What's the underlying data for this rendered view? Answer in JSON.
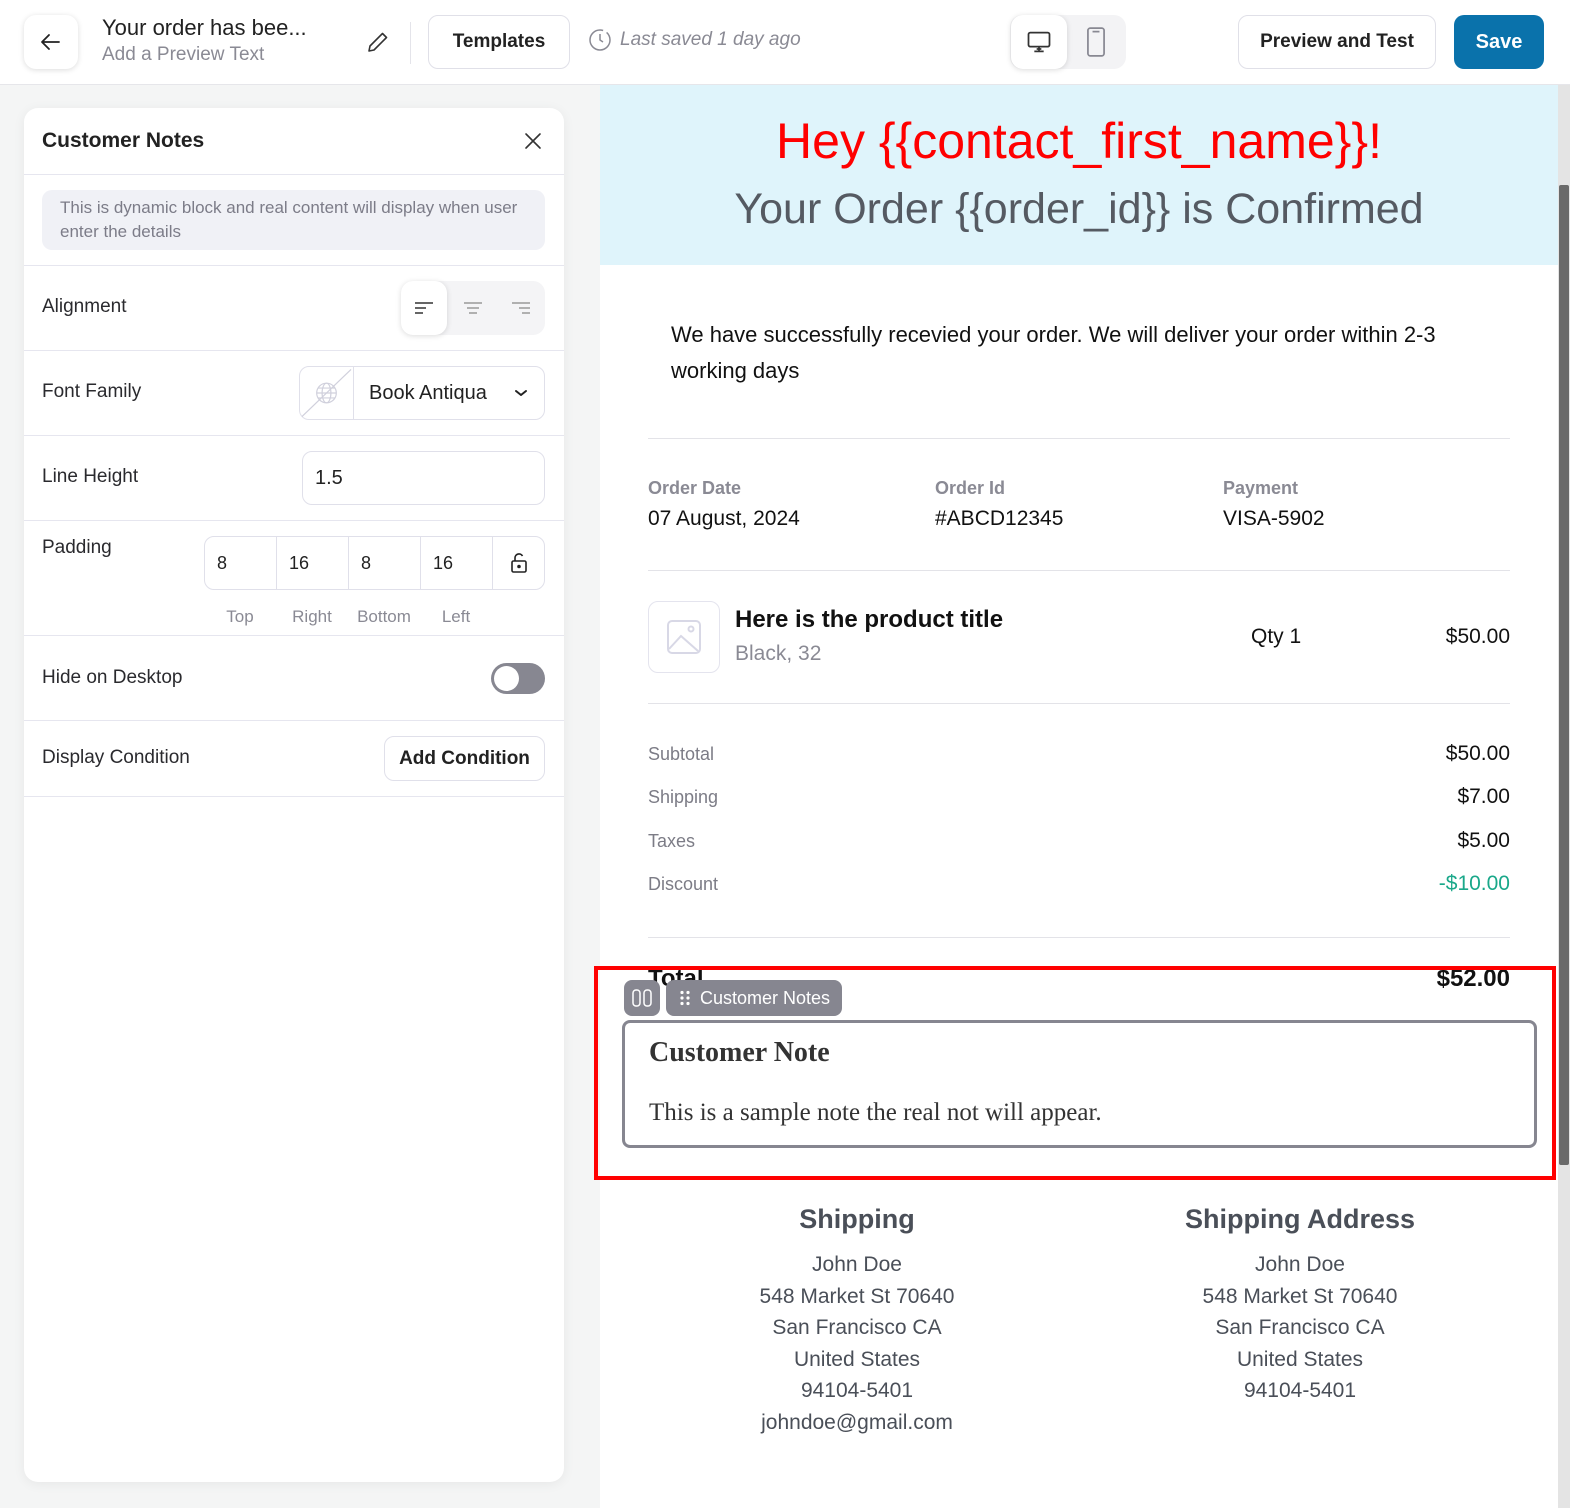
{
  "topbar": {
    "title": "Your order has bee...",
    "subtitle": "Add a Preview Text",
    "templates_label": "Templates",
    "last_saved": "Last saved 1 day ago",
    "preview_label": "Preview and Test",
    "save_label": "Save",
    "active_device": "desktop",
    "save_color": "#0a72ab"
  },
  "panel": {
    "title": "Customer Notes",
    "info": "This is dynamic block and real content will display when user enter the details",
    "alignment": {
      "label": "Alignment",
      "options": [
        "left",
        "center",
        "right"
      ],
      "selected": "left"
    },
    "font_family": {
      "label": "Font Family",
      "value": "Book Antiqua"
    },
    "line_height": {
      "label": "Line Height",
      "value": "1.5"
    },
    "padding": {
      "label": "Padding",
      "top": "8",
      "right": "16",
      "bottom": "8",
      "left": "16",
      "labels": [
        "Top",
        "Right",
        "Bottom",
        "Left"
      ],
      "locked": false
    },
    "hide_on_desktop": {
      "label": "Hide on Desktop",
      "value": false
    },
    "display_condition": {
      "label": "Display Condition",
      "button": "Add Condition"
    }
  },
  "email": {
    "greeting": "Hey {{contact_first_name}}!",
    "heading": "Your Order {{order_id}} is Confirmed",
    "intro": "We have successfully recevied your order. We will deliver your order within 2-3 working days",
    "meta": [
      {
        "label": "Order Date",
        "value": "07 August, 2024"
      },
      {
        "label": "Order Id",
        "value": "#ABCD12345"
      },
      {
        "label": "Payment",
        "value": "VISA-5902"
      }
    ],
    "product": {
      "title": "Here is the product title",
      "variant": "Black, 32",
      "qty": "Qty 1",
      "price": "$50.00"
    },
    "summary": [
      {
        "label": "Subtotal",
        "value": "$50.00"
      },
      {
        "label": "Shipping",
        "value": "$7.00"
      },
      {
        "label": "Taxes",
        "value": "$5.00"
      },
      {
        "label": "Discount",
        "value": "-$10.00",
        "color": "#1aa88a"
      }
    ],
    "total": {
      "label": "Total",
      "value": "$52.00"
    },
    "block_label": "Customer Notes",
    "note": {
      "title": "Customer Note",
      "text": "This is a sample note the real not will appear."
    },
    "shipping": {
      "title": "Shipping",
      "lines": [
        "John Doe",
        "548 Market St 70640",
        "San Francisco CA",
        "United States",
        "94104-5401",
        "johndoe@gmail.com"
      ]
    },
    "shipping_address": {
      "title": "Shipping Address",
      "lines": [
        "John Doe",
        "548 Market St 70640",
        "San Francisco CA",
        "United States",
        "94104-5401"
      ]
    },
    "greeting_color": "#ff0000",
    "hero_bg": "#dff4fb",
    "highlight_color": "#ff0000"
  }
}
